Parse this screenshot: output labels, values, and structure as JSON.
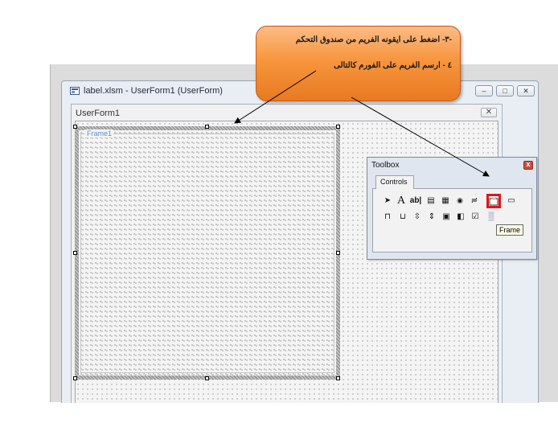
{
  "editor": {
    "title": "label.xlsm - UserForm1 (UserForm)",
    "minimize": "–",
    "maximize": "□",
    "close": "✕"
  },
  "userform": {
    "title": "UserForm1",
    "close": "✕",
    "frame_caption": "Frame1"
  },
  "toolbox": {
    "title": "Toolbox",
    "close": "x",
    "tab": "Controls",
    "row1": [
      {
        "name": "select-objects-icon",
        "glyph": "➤"
      },
      {
        "name": "label-icon",
        "glyph": "A"
      },
      {
        "name": "textbox-icon",
        "glyph": "ab|"
      },
      {
        "name": "combobox-icon",
        "glyph": "▤"
      },
      {
        "name": "listbox-icon",
        "glyph": "▦"
      },
      {
        "name": "optionbutton-icon",
        "glyph": "◉"
      },
      {
        "name": "togglebutton-icon",
        "glyph": "≓"
      },
      {
        "name": "frame-icon",
        "glyph": "[xyz]"
      },
      {
        "name": "commandbutton-icon",
        "glyph": "▭"
      }
    ],
    "row2": [
      {
        "name": "tabstrip-icon",
        "glyph": "⊓"
      },
      {
        "name": "multipage-icon",
        "glyph": "⊔"
      },
      {
        "name": "scrollbar-icon",
        "glyph": "⇳"
      },
      {
        "name": "spinbutton-icon",
        "glyph": "⇕"
      },
      {
        "name": "image-icon",
        "glyph": "▣"
      },
      {
        "name": "refedit-icon",
        "glyph": "◧"
      },
      {
        "name": "checkbox-icon",
        "glyph": "☑"
      },
      {
        "name": "hatch-icon",
        "glyph": "▒"
      }
    ],
    "tooltip": "Frame"
  },
  "callout": {
    "line1": "-٣- اضغط على ايقونه الفريم من صندوق التحكم",
    "line2": "٤ - ارسم الفريم على الفورم كالتالى"
  },
  "colors": {
    "callout": "#f7963e",
    "highlight": "#e2141d",
    "frame_caption": "#5b8fd6"
  }
}
